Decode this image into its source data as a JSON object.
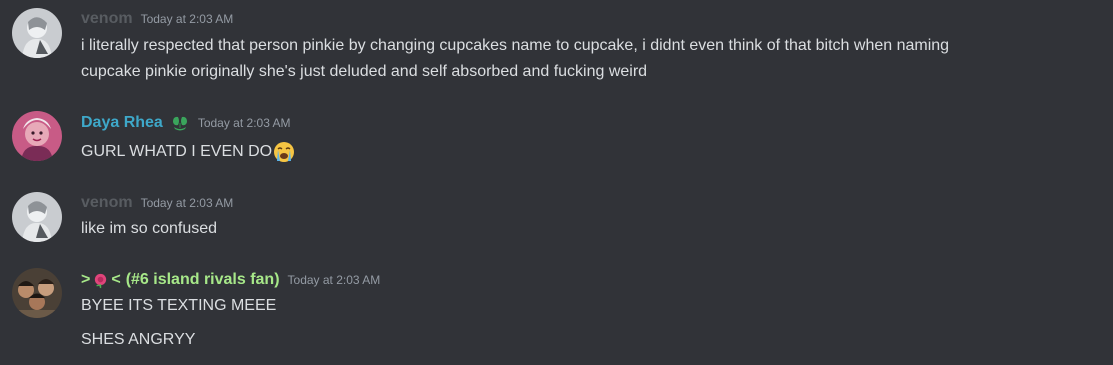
{
  "colors": {
    "background": "#313338",
    "text": "#dbdee1",
    "timestamp": "#949ba4",
    "venom_name": "#585c61",
    "daya_name": "#3ea8c9",
    "rivals_name": "#a7e889",
    "badge": "#3aa55c"
  },
  "messages": [
    {
      "username": "venom",
      "timestamp": "Today at 2:03 AM",
      "lines": [
        "i literally respected that person pinkie by changing cupcakes name to cupcake, i didnt even think of that bitch when naming",
        "cupcake pinkie originally she's just deluded and self absorbed and fucking weird"
      ]
    },
    {
      "username": "Daya Rhea",
      "badge_icon": "leaf-badge-icon",
      "timestamp": "Today at 2:03 AM",
      "lines": [
        "GURL WHATD I EVEN DO"
      ],
      "emoji": "loudly-crying-face-emoji"
    },
    {
      "username": "venom",
      "timestamp": "Today at 2:03 AM",
      "lines": [
        "like im so confused"
      ]
    },
    {
      "username_prefix": "˃",
      "username_suffix": "˂",
      "username": "(#6 island rivals fan)",
      "prefix_icon": "rose-icon",
      "timestamp": "Today at 2:03 AM",
      "lines": [
        "BYEE ITS TEXTING MEEE",
        "SHES ANGRYY"
      ]
    }
  ]
}
